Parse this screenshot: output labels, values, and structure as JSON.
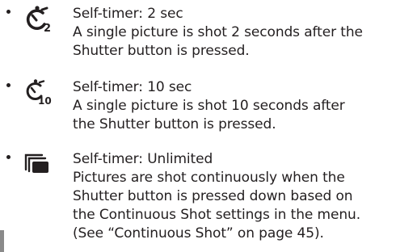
{
  "items": [
    {
      "icon": "self-timer-2sec-icon",
      "title": "Self-timer: 2 sec",
      "lines": [
        "A single picture is shot 2 seconds after the",
        "Shutter button is pressed."
      ]
    },
    {
      "icon": "self-timer-10sec-icon",
      "title": "Self-timer: 10 sec",
      "lines": [
        "A single picture is shot 10 seconds after",
        "the Shutter button is pressed."
      ]
    },
    {
      "icon": "continuous-shot-icon",
      "title": "Self-timer: Unlimited",
      "lines": [
        "Pictures are shot continuously when the",
        "Shutter button is pressed down based on",
        "the Continuous Shot settings in the menu.",
        "(See “Continuous Shot” on page 45)."
      ]
    }
  ],
  "colors": {
    "text": "#231f20",
    "tab": "#8a8a8a"
  }
}
